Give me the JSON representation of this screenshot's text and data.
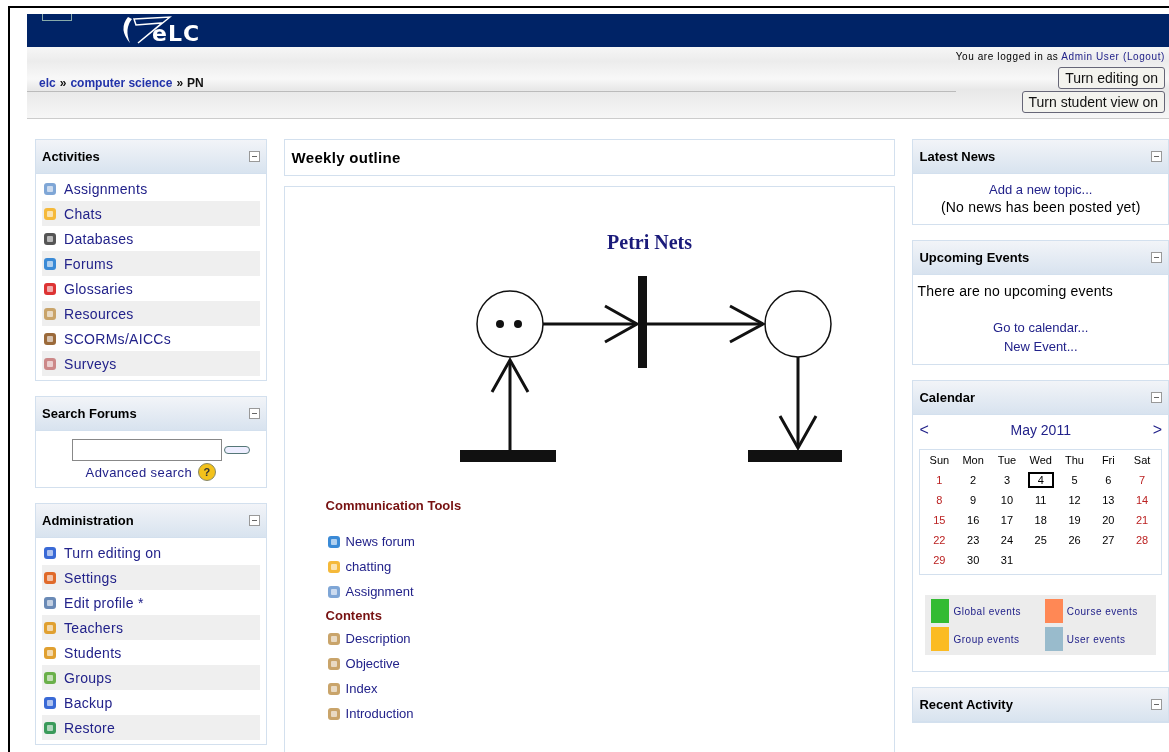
{
  "header": {
    "logo": "eLC"
  },
  "nav": {
    "login_prefix": "You are logged in as",
    "user": "Admin User",
    "logout": "(Logout)",
    "breadcrumb": [
      {
        "label": "elc",
        "current": false
      },
      {
        "label": "»",
        "kind": "sep"
      },
      {
        "label": "computer science",
        "current": false
      },
      {
        "label": "»",
        "kind": "sep"
      },
      {
        "label": "PN",
        "current": true
      }
    ],
    "buttons": [
      "Turn editing on",
      "Turn student view on"
    ]
  },
  "activities": {
    "title": "Activities",
    "items": [
      "Assignments",
      "Chats",
      "Databases",
      "Forums",
      "Glossaries",
      "Resources",
      "SCORMs/AICCs",
      "Surveys"
    ]
  },
  "search_forums": {
    "title": "Search Forums",
    "advanced": "Advanced search",
    "help": "?"
  },
  "administration": {
    "title": "Administration",
    "items": [
      "Turn editing on",
      "Settings",
      "Edit profile *",
      "Teachers",
      "Students",
      "Groups",
      "Backup",
      "Restore"
    ]
  },
  "main": {
    "title": "Weekly outline",
    "heading": "Petri Nets",
    "sections": [
      {
        "title": "Communication Tools",
        "items": [
          "News forum",
          "chatting",
          "Assignment"
        ]
      },
      {
        "title": "Contents",
        "items": [
          "Description",
          "Objective",
          "Index",
          "Introduction"
        ]
      }
    ]
  },
  "latest_news": {
    "title": "Latest News",
    "link": "Add a new topic...",
    "note": "(No news has been posted yet)"
  },
  "upcoming": {
    "title": "Upcoming Events",
    "note": "There are no upcoming events",
    "links": [
      "Go to calendar...",
      "New Event..."
    ]
  },
  "calendar": {
    "title": "Calendar",
    "prev": "<",
    "month": "May 2011",
    "next": ">",
    "weekdays": [
      "Sun",
      "Mon",
      "Tue",
      "Wed",
      "Thu",
      "Fri",
      "Sat"
    ],
    "weeks": [
      [
        {
          "day": "1",
          "selected": false
        },
        {
          "day": "2",
          "selected": false
        },
        {
          "day": "3",
          "selected": false
        },
        {
          "day": "4",
          "selected": true
        },
        {
          "day": "5",
          "selected": false
        },
        {
          "day": "6",
          "selected": false
        },
        {
          "day": "7",
          "selected": false
        }
      ],
      [
        {
          "day": "8",
          "selected": false
        },
        {
          "day": "9",
          "selected": false
        },
        {
          "day": "10",
          "selected": false
        },
        {
          "day": "11",
          "selected": false
        },
        {
          "day": "12",
          "selected": false
        },
        {
          "day": "13",
          "selected": false
        },
        {
          "day": "14",
          "selected": false
        }
      ],
      [
        {
          "day": "15",
          "selected": false
        },
        {
          "day": "16",
          "selected": false
        },
        {
          "day": "17",
          "selected": false
        },
        {
          "day": "18",
          "selected": false
        },
        {
          "day": "19",
          "selected": false
        },
        {
          "day": "20",
          "selected": false
        },
        {
          "day": "21",
          "selected": false
        }
      ],
      [
        {
          "day": "22",
          "selected": false
        },
        {
          "day": "23",
          "selected": false
        },
        {
          "day": "24",
          "selected": false
        },
        {
          "day": "25",
          "selected": false
        },
        {
          "day": "26",
          "selected": false
        },
        {
          "day": "27",
          "selected": false
        },
        {
          "day": "28",
          "selected": false
        }
      ],
      [
        {
          "day": "29",
          "selected": false
        },
        {
          "day": "30",
          "selected": false
        },
        {
          "day": "31",
          "selected": false
        }
      ]
    ],
    "legend": [
      {
        "label": "Global events",
        "color": "#33bb33"
      },
      {
        "label": "Course events",
        "color": "#ff8855"
      },
      {
        "label": "Group events",
        "color": "#fbbb22"
      },
      {
        "label": "User events",
        "color": "#99bbcc"
      }
    ]
  },
  "recent_activity": {
    "title": "Recent Activity"
  }
}
